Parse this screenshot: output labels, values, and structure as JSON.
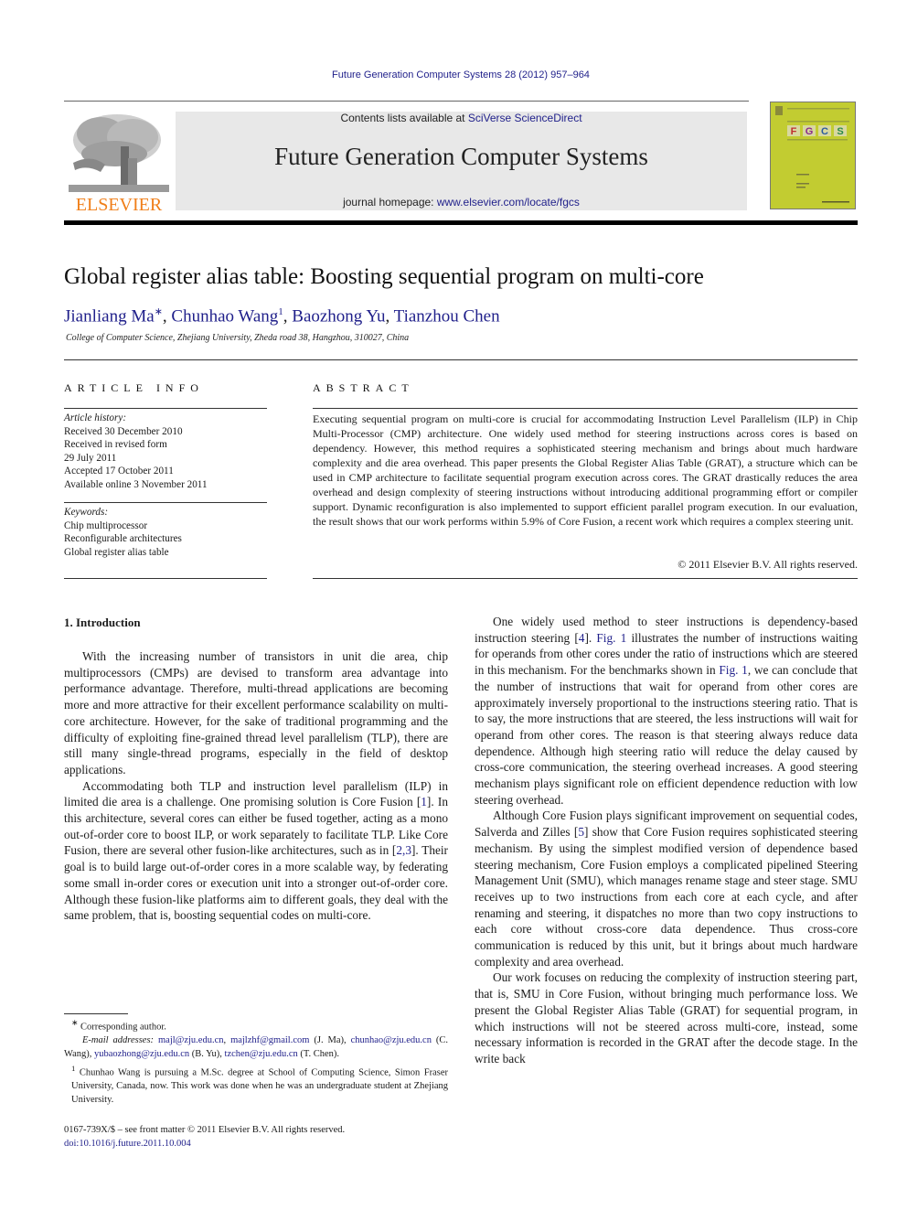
{
  "header": {
    "journal_ref": "Future Generation Computer Systems 28 (2012) 957–964",
    "contents_prefix": "Contents lists available at ",
    "contents_link": "SciVerse ScienceDirect",
    "journal_title": "Future Generation Computer Systems",
    "homepage_prefix": "journal homepage: ",
    "homepage_link": "www.elsevier.com/locate/fgcs",
    "publisher_logo_text": "ELSEVIER",
    "cover_title": "FGCS",
    "colors": {
      "publisher_orange": "#f07f1a",
      "link_blue": "#1f1f8a",
      "cover_green": "#c2cc31",
      "banner_gray": "#e8e8e8"
    }
  },
  "article": {
    "title": "Global register alias table: Boosting sequential program on multi-core",
    "authors": [
      {
        "name": "Jianliang Ma",
        "mark": "∗"
      },
      {
        "name": "Chunhao Wang",
        "mark": "1"
      },
      {
        "name": "Baozhong Yu",
        "mark": ""
      },
      {
        "name": "Tianzhou Chen",
        "mark": ""
      }
    ],
    "affiliation": "College of Computer Science, Zhejiang University, Zheda road 38, Hangzhou, 310027, China"
  },
  "article_info": {
    "heading": "ARTICLE INFO",
    "history_label": "Article history:",
    "history": [
      "Received 30 December 2010",
      "Received in revised form",
      "29 July 2011",
      "Accepted 17 October 2011",
      "Available online 3 November 2011"
    ],
    "keywords_label": "Keywords:",
    "keywords": [
      "Chip multiprocessor",
      "Reconfigurable architectures",
      "Global register alias table"
    ]
  },
  "abstract": {
    "heading": "ABSTRACT",
    "text": "Executing sequential program on multi-core is crucial for accommodating Instruction Level Parallelism (ILP) in Chip Multi-Processor (CMP) architecture. One widely used method for steering instructions across cores is based on dependency. However, this method requires a sophisticated steering mechanism and brings about much hardware complexity and die area overhead. This paper presents the Global Register Alias Table (GRAT), a structure which can be used in CMP architecture to facilitate sequential program execution across cores. The GRAT drastically reduces the area overhead and design complexity of steering instructions without introducing additional programming effort or compiler support. Dynamic reconfiguration is also implemented to support efficient parallel program execution. In our evaluation, the result shows that our work performs within 5.9% of Core Fusion, a recent work which requires a complex steering unit.",
    "copyright": "© 2011 Elsevier B.V. All rights reserved."
  },
  "body": {
    "section_heading": "1.  Introduction",
    "left_paragraphs": [
      {
        "parts": [
          {
            "t": "With the increasing number of transistors in unit die area, chip multiprocessors (CMPs) are devised to transform area advantage into performance advantage. Therefore, multi-thread applications are becoming more and more attractive for their excellent performance scalability on multi-core architecture. However, for the sake of traditional programming and the difficulty of exploiting fine-grained thread level parallelism (TLP), there are still many single-thread programs, especially in the field of desktop applications."
          }
        ]
      },
      {
        "parts": [
          {
            "t": "Accommodating both TLP and instruction level parallelism (ILP) in limited die area is a challenge. One promising solution is Core Fusion ["
          },
          {
            "t": "1",
            "link": true
          },
          {
            "t": "]. In this architecture, several cores can either be fused together, acting as a mono out-of-order core to boost ILP, or work separately to facilitate TLP. Like Core Fusion, there are several other fusion-like architectures, such as in ["
          },
          {
            "t": "2,3",
            "link": true
          },
          {
            "t": "]. Their goal is to build large out-of-order cores in a more scalable way, by federating some small in-order cores or execution unit into a stronger out-of-order core. Although these fusion-like platforms aim to different goals, they deal with the same problem, that is, boosting sequential codes on multi-core."
          }
        ]
      }
    ],
    "right_paragraphs": [
      {
        "parts": [
          {
            "t": "One widely used method to steer instructions is dependency-based instruction steering ["
          },
          {
            "t": "4",
            "link": true
          },
          {
            "t": "]. "
          },
          {
            "t": "Fig. 1",
            "link": true
          },
          {
            "t": " illustrates the number of instructions waiting for operands from other cores under the ratio of instructions which are steered in this mechanism. For the benchmarks shown in "
          },
          {
            "t": "Fig. 1",
            "link": true
          },
          {
            "t": ", we can conclude that the number of instructions that wait for operand from other cores are approximately inversely proportional to the instructions steering ratio. That is to say, the more instructions that are steered, the less instructions will wait for operand from other cores. The reason is that steering always reduce data dependence. Although high steering ratio will reduce the delay caused by cross-core communication, the steering overhead increases. A good steering mechanism plays significant role on efficient dependence reduction with low steering overhead."
          }
        ]
      },
      {
        "parts": [
          {
            "t": "Although Core Fusion plays significant improvement on sequential codes, Salverda and Zilles ["
          },
          {
            "t": "5",
            "link": true
          },
          {
            "t": "] show that Core Fusion requires sophisticated steering mechanism. By using the simplest modified version of dependence based steering mechanism, Core Fusion employs a complicated pipelined Steering Management Unit (SMU), which manages rename stage and steer stage. SMU receives up to two instructions from each core at each cycle, and after renaming and steering, it dispatches no more than two copy instructions to each core without cross-core data dependence. Thus cross-core communication is reduced by this unit, but it brings about much hardware complexity and area overhead."
          }
        ]
      },
      {
        "parts": [
          {
            "t": "Our work focuses on reducing the complexity of instruction steering part, that is, SMU in Core Fusion, without bringing much performance loss. We present the Global Register Alias Table (GRAT) for sequential program, in which instructions will not be steered across multi-core, instead, some necessary information is recorded in the GRAT after the decode stage. In the write back"
          }
        ]
      }
    ]
  },
  "footnotes": {
    "corresponding_mark": "∗",
    "corresponding": "Corresponding author.",
    "email_label": "E-mail addresses:",
    "emails": [
      {
        "addr": "majl@zju.edu.cn",
        "sep": ", "
      },
      {
        "addr": "majlzhf@gmail.com",
        "sep": " (J. Ma), "
      },
      {
        "addr": "chunhao@zju.edu.cn",
        "sep": " (C. Wang), "
      },
      {
        "addr": "yubaozhong@zju.edu.cn",
        "sep": " (B. Yu), "
      },
      {
        "addr": "tzchen@zju.edu.cn",
        "sep": " (T. Chen)."
      }
    ],
    "note1_mark": "1",
    "note1": "Chunhao Wang is pursuing a M.Sc. degree at School of Computing Science, Simon Fraser University, Canada, now. This work was done when he was an undergraduate student at Zhejiang University.",
    "front_matter": "0167-739X/$ – see front matter © 2011 Elsevier B.V. All rights reserved.",
    "doi": "doi:10.1016/j.future.2011.10.004"
  }
}
